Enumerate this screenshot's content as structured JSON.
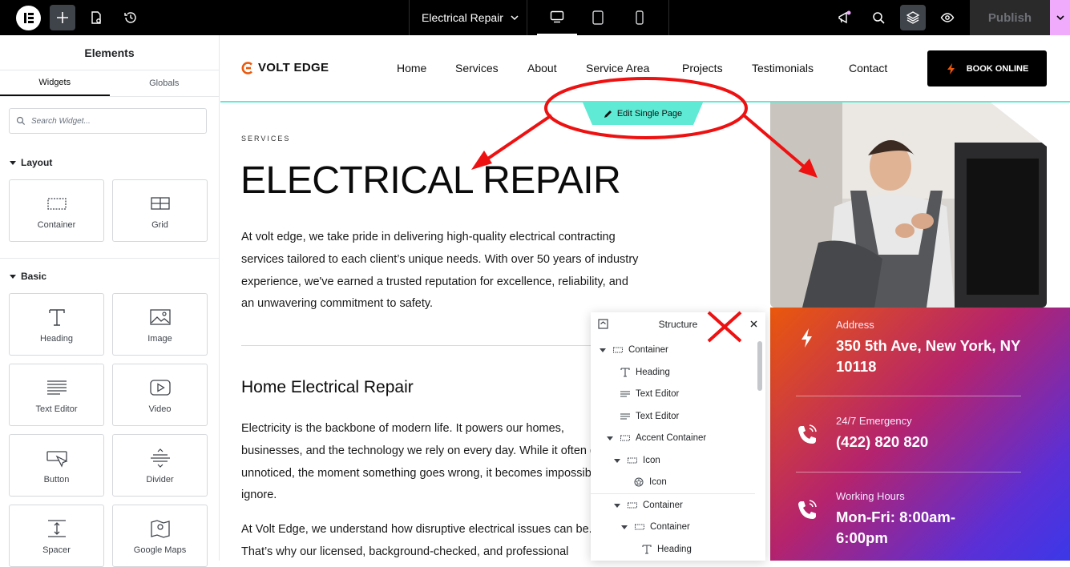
{
  "topbar": {
    "page_title": "Electrical Repair",
    "publish_label": "Publish"
  },
  "panel": {
    "title": "Elements",
    "tabs": [
      "Widgets",
      "Globals"
    ],
    "search_placeholder": "Search Widget...",
    "categories": {
      "layout": "Layout",
      "basic": "Basic"
    },
    "layout_widgets": [
      "Container",
      "Grid"
    ],
    "basic_widgets": [
      "Heading",
      "Image",
      "Text Editor",
      "Video",
      "Button",
      "Divider",
      "Spacer",
      "Google Maps"
    ]
  },
  "site": {
    "logo": "VOLT EDGE",
    "nav": [
      "Home",
      "Services",
      "About",
      "Service Area",
      "Projects",
      "Testimonials",
      "Contact"
    ],
    "book_label": "BOOK ONLINE",
    "edit_label": "Edit Single Page",
    "eyebrow": "SERVICES",
    "title": "ELECTRICAL REPAIR",
    "intro": "At volt edge, we take pride in delivering high-quality electrical contracting services tailored to each client’s unique needs. With over 50 years of industry experience, we've earned a trusted reputation for excellence, reliability, and an unwavering commitment to safety.",
    "subtitle": "Home Electrical Repair",
    "body1": "Electricity is the backbone of modern life. It powers our homes, businesses, and the technology we rely on every day. While it often goes unnoticed, the moment something goes wrong, it becomes impossible to ignore.",
    "body2": "At Volt Edge, we understand how disruptive electrical issues can be. That’s why our licensed, background-checked, and professional",
    "info": [
      {
        "label": "Address",
        "value": "350 5th Ave, New York, NY 10118"
      },
      {
        "label": "24/7 Emergency",
        "value": "(422) 820 820"
      },
      {
        "label": "Working Hours",
        "value": "Mon-Fri: 8:00am-6:00pm"
      }
    ]
  },
  "structure": {
    "title": "Structure",
    "items": [
      "Container",
      "Heading",
      "Text Editor",
      "Text Editor",
      "Accent Container",
      "Icon",
      "Icon",
      "Container",
      "Container",
      "Heading"
    ]
  },
  "colors": {
    "accent_teal": "#5eead4",
    "brand_orange": "#ea580c",
    "annotation_red": "#ee1111"
  }
}
